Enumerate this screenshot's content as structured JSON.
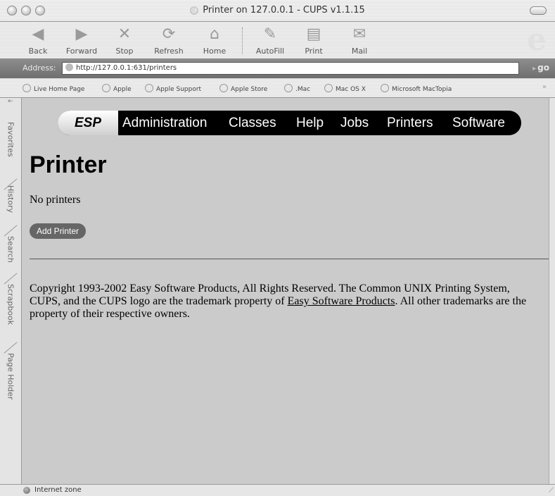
{
  "window": {
    "title": "Printer on 127.0.0.1 - CUPS v1.1.15"
  },
  "toolbar": {
    "buttons": [
      {
        "label": "Back",
        "icon": "back-arrow-icon"
      },
      {
        "label": "Forward",
        "icon": "forward-arrow-icon"
      },
      {
        "label": "Stop",
        "icon": "stop-x-icon"
      },
      {
        "label": "Refresh",
        "icon": "refresh-icon"
      },
      {
        "label": "Home",
        "icon": "home-icon"
      },
      {
        "label": "AutoFill",
        "icon": "autofill-icon"
      },
      {
        "label": "Print",
        "icon": "printer-icon"
      },
      {
        "label": "Mail",
        "icon": "mail-icon"
      }
    ]
  },
  "address": {
    "label": "Address:",
    "url": "http://127.0.0.1:631/printers",
    "go": "go"
  },
  "favorites": [
    "Live Home Page",
    "Apple",
    "Apple Support",
    "Apple Store",
    ".Mac",
    "Mac OS X",
    "Microsoft MacTopia"
  ],
  "sidebar_tabs": [
    "Favorites",
    "History",
    "Search",
    "Scrapbook",
    "Page Holder"
  ],
  "page": {
    "nav": {
      "brand": "ESP",
      "items": [
        "Administration",
        "Classes",
        "Help",
        "Jobs",
        "Printers",
        "Software"
      ]
    },
    "heading": "Printer",
    "message": "No printers",
    "add_button": "Add Printer",
    "copyright_pre": "Copyright 1993-2002 Easy Software Products, All Rights Reserved. The Common UNIX Printing System, CUPS, and the CUPS logo are the trademark property of ",
    "copyright_link": "Easy Software Products",
    "copyright_post": ". All other trademarks are the property of their respective owners."
  },
  "status": {
    "text": "Internet zone"
  }
}
